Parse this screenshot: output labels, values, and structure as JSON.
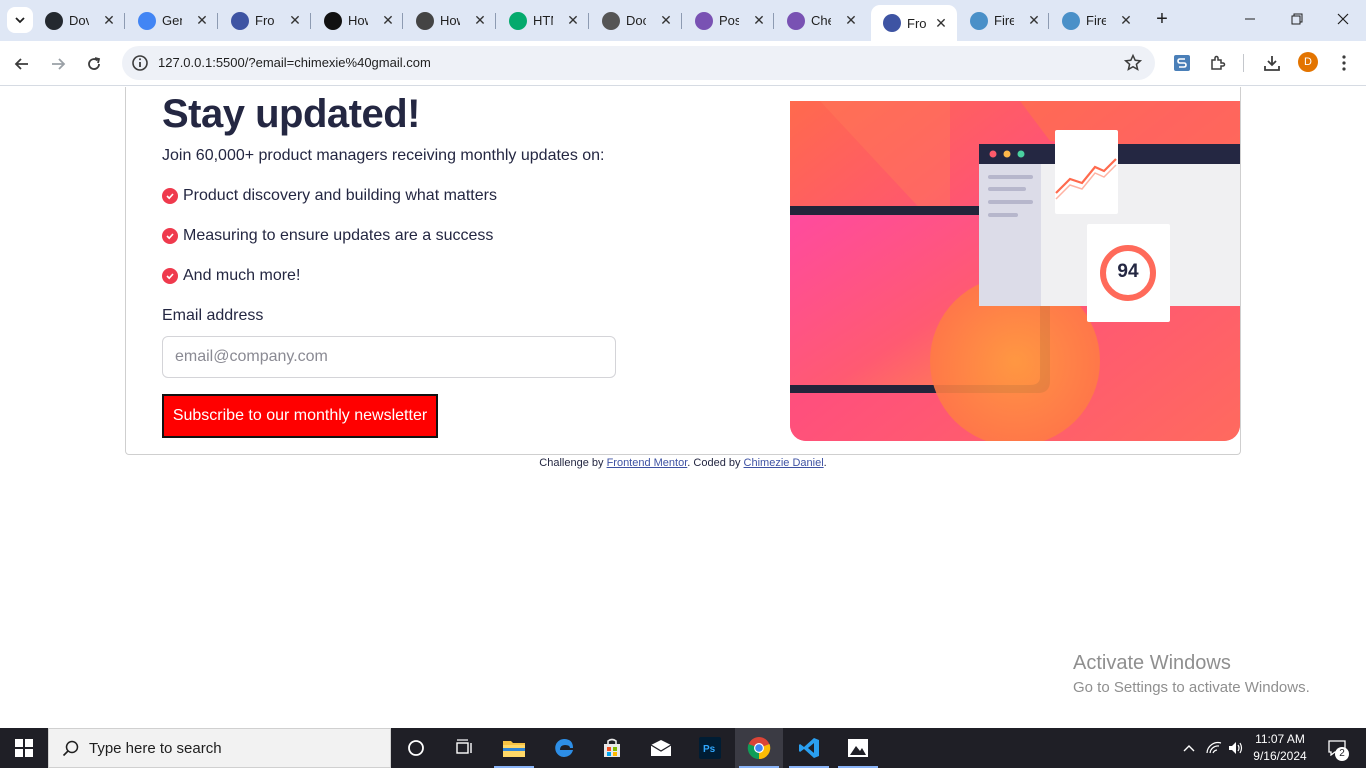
{
  "browser": {
    "tabs": [
      {
        "title": "Dov",
        "icon": "github-icon",
        "color": "#24292f"
      },
      {
        "title": "Gen",
        "icon": "gemini-icon",
        "color": "#4285f4"
      },
      {
        "title": "Fron",
        "icon": "frontend-mentor-icon",
        "color": "#3e54a3"
      },
      {
        "title": "How",
        "icon": "medium-icon",
        "color": "#111111"
      },
      {
        "title": "How",
        "icon": "openai-icon",
        "color": "#444444"
      },
      {
        "title": "HTM",
        "icon": "w3-icon",
        "color": "#04aa6d"
      },
      {
        "title": "Doc",
        "icon": "globe-icon",
        "color": "#555555"
      },
      {
        "title": "Posi",
        "icon": "bootstrap-icon",
        "color": "#7952b3"
      },
      {
        "title": "Che",
        "icon": "bootstrap-icon",
        "color": "#7952b3"
      },
      {
        "title": "Fron",
        "icon": "frontend-mentor-icon",
        "color": "#3e54a3",
        "active": true
      },
      {
        "title": "Fire",
        "icon": "firebase-s-icon",
        "color": "#4a90c8"
      },
      {
        "title": "Fire",
        "icon": "firebase-s-icon",
        "color": "#4a90c8"
      }
    ],
    "url": "127.0.0.1:5500/?email=chimexie%40gmail.com",
    "profile_initial": "D"
  },
  "page": {
    "headline": "Stay updated!",
    "intro": "Join 60,000+ product managers receiving monthly updates on:",
    "features": [
      "Product discovery and building what matters",
      "Measuring to ensure updates are a success",
      "And much more!"
    ],
    "email_label": "Email address",
    "email_placeholder": "email@company.com",
    "email_value": "",
    "subscribe_label": "Subscribe to our monthly newsletter",
    "hero_score": "94",
    "accent_color": "#ef3a4d",
    "button_color": "#ff0000",
    "attribution": {
      "prefix": "Challenge by ",
      "link1": "Frontend Mentor",
      "middle": ". Coded by ",
      "link2": "Chimezie Daniel",
      "suffix": "."
    }
  },
  "watermark": {
    "title": "Activate Windows",
    "subtitle": "Go to Settings to activate Windows."
  },
  "taskbar": {
    "search_placeholder": "Type here to search",
    "time": "11:07 AM",
    "date": "9/16/2024",
    "notification_count": "2"
  }
}
